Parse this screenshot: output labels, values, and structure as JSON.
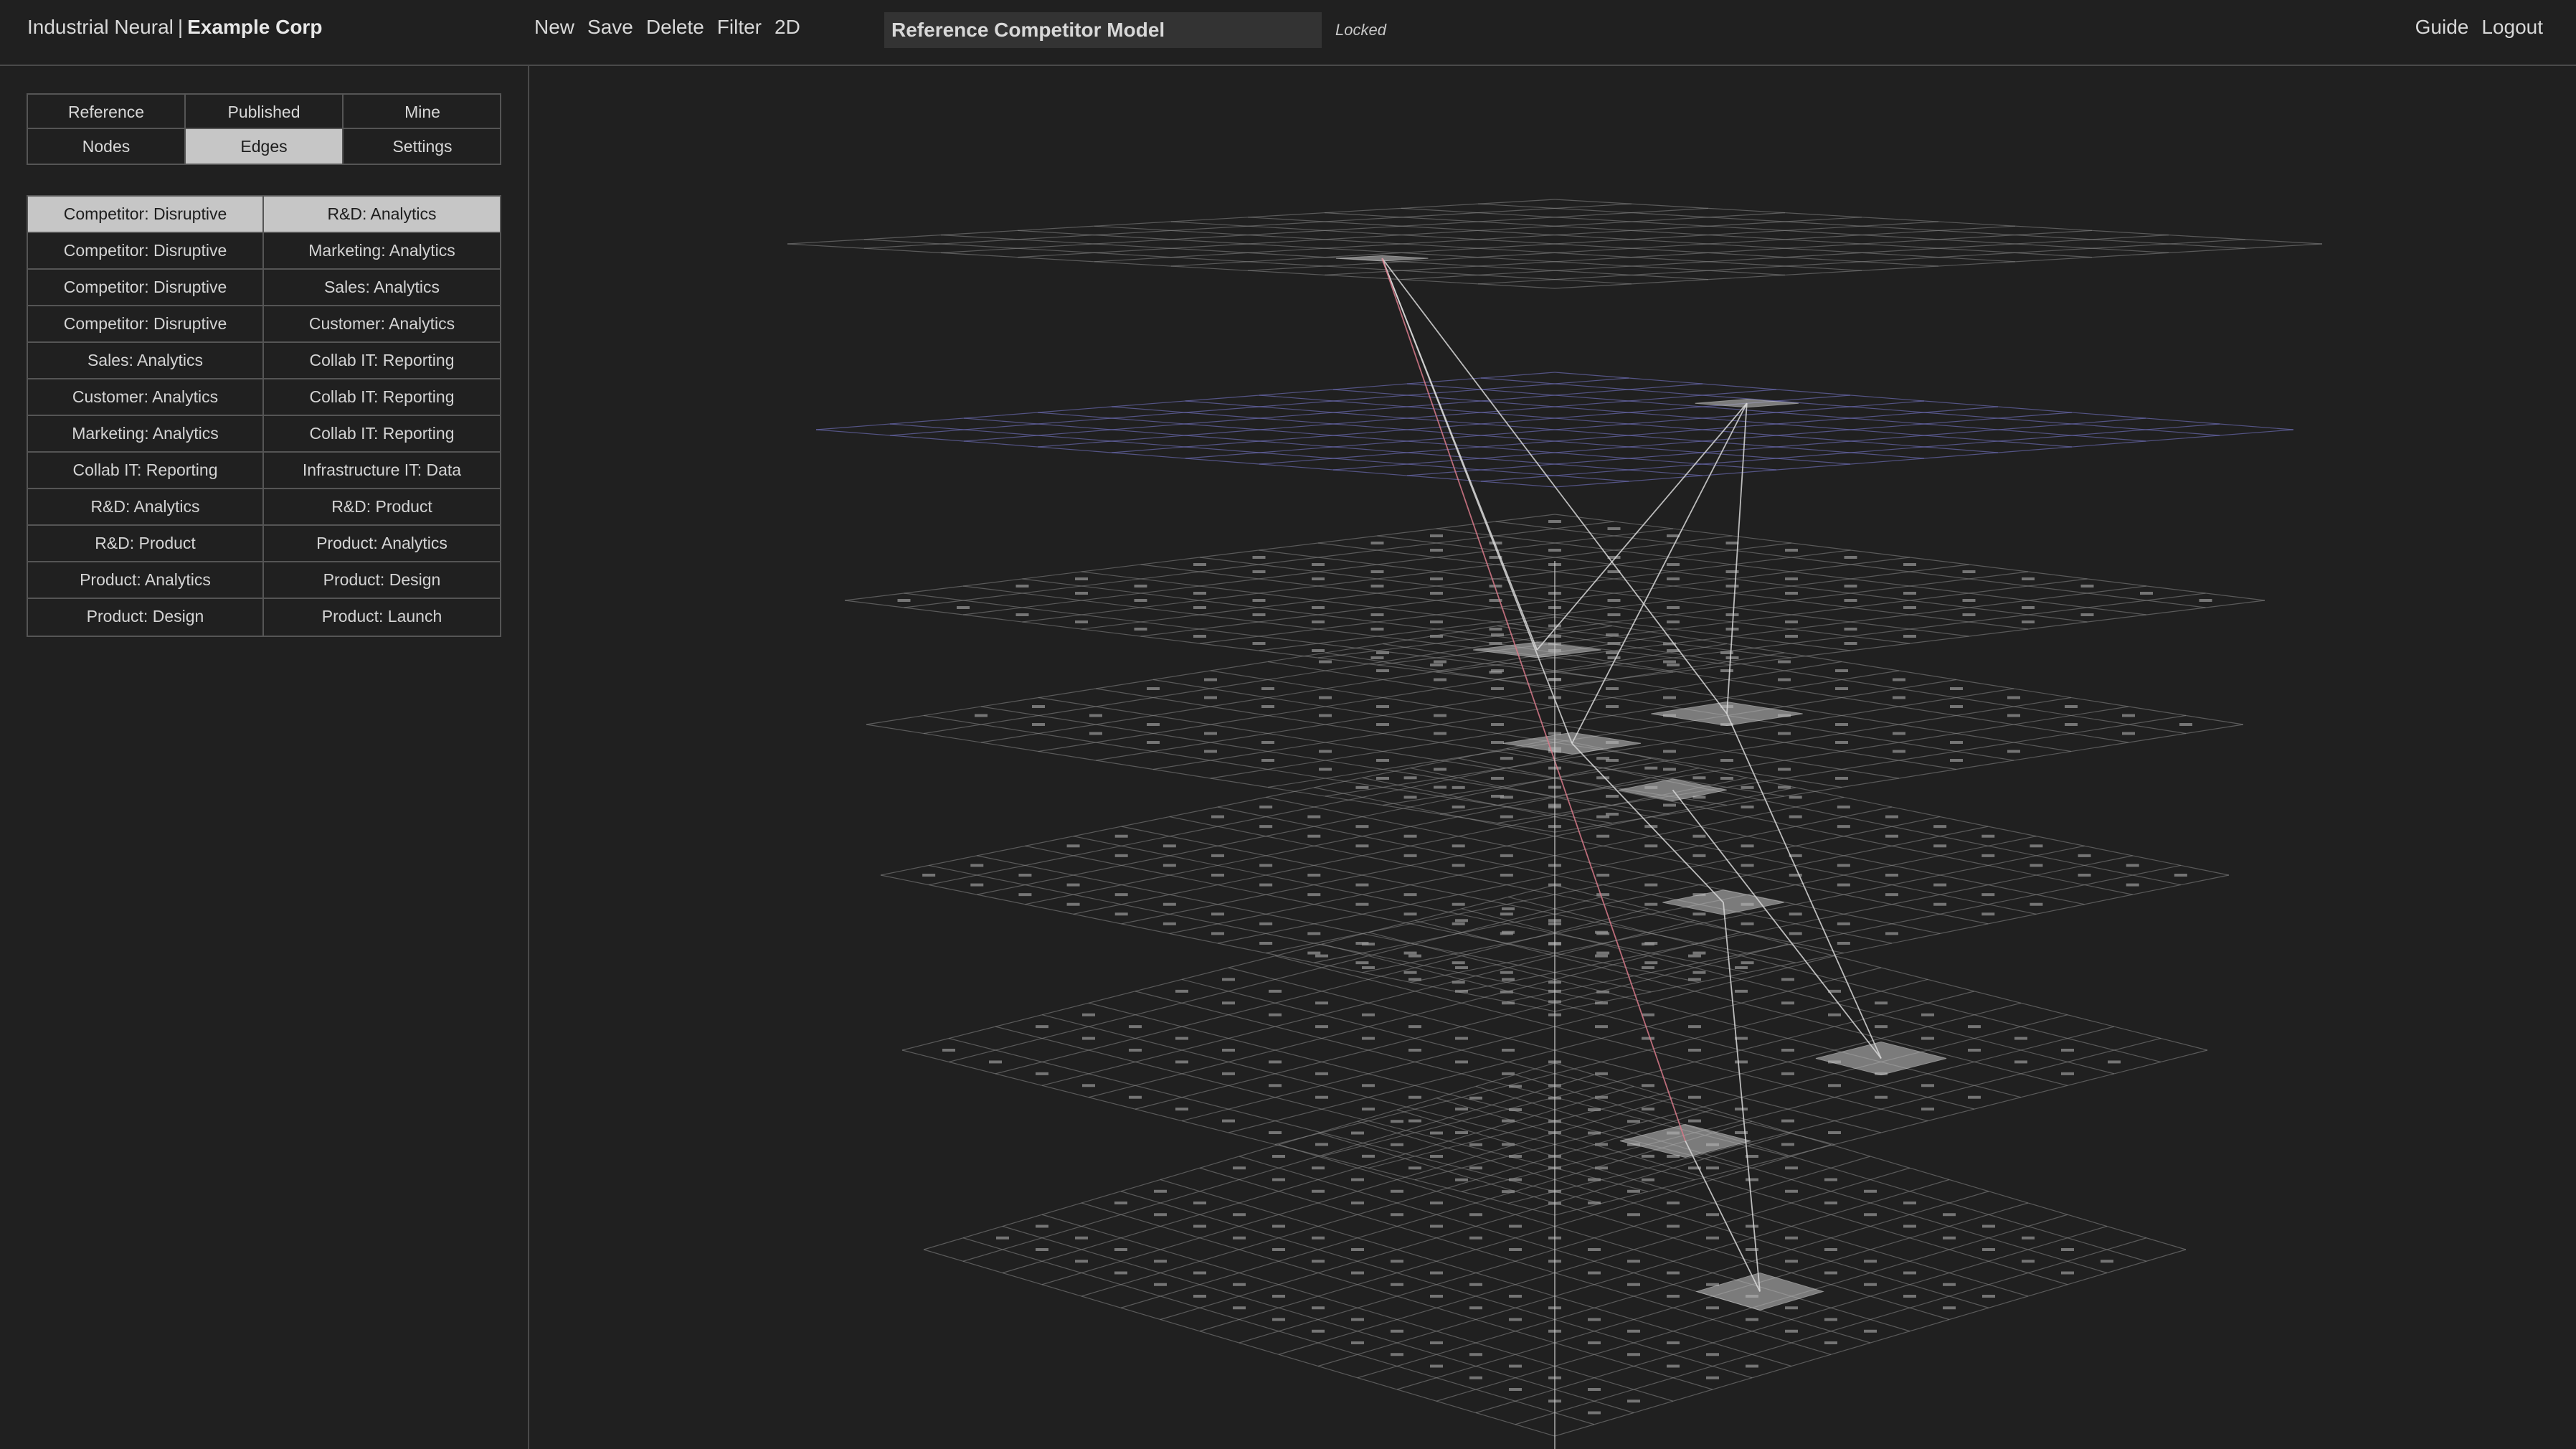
{
  "header": {
    "brand": "Industrial Neural",
    "separator": "|",
    "company": "Example Corp",
    "menu": [
      "New",
      "Save",
      "Delete",
      "Filter",
      "2D"
    ],
    "model_title": "Reference Competitor Model",
    "status": "Locked",
    "right_links": [
      "Guide",
      "Logout"
    ]
  },
  "sidebar": {
    "tabs": [
      {
        "label": "Reference",
        "active": false
      },
      {
        "label": "Published",
        "active": false
      },
      {
        "label": "Mine",
        "active": false
      },
      {
        "label": "Nodes",
        "active": false
      },
      {
        "label": "Edges",
        "active": true
      },
      {
        "label": "Settings",
        "active": false
      }
    ],
    "edges": [
      {
        "from": "Competitor: Disruptive",
        "to": "R&D: Analytics",
        "selected": true
      },
      {
        "from": "Competitor: Disruptive",
        "to": "Marketing: Analytics",
        "selected": false
      },
      {
        "from": "Competitor: Disruptive",
        "to": "Sales: Analytics",
        "selected": false
      },
      {
        "from": "Competitor: Disruptive",
        "to": "Customer: Analytics",
        "selected": false
      },
      {
        "from": "Sales: Analytics",
        "to": "Collab IT: Reporting",
        "selected": false
      },
      {
        "from": "Customer: Analytics",
        "to": "Collab IT: Reporting",
        "selected": false
      },
      {
        "from": "Marketing: Analytics",
        "to": "Collab IT: Reporting",
        "selected": false
      },
      {
        "from": "Collab IT: Reporting",
        "to": "Infrastructure IT: Data",
        "selected": false
      },
      {
        "from": "R&D: Analytics",
        "to": "R&D: Product",
        "selected": false
      },
      {
        "from": "R&D: Product",
        "to": "Product: Analytics",
        "selected": false
      },
      {
        "from": "Product: Analytics",
        "to": "Product: Design",
        "selected": false
      },
      {
        "from": "Product: Design",
        "to": "Product: Launch",
        "selected": false
      }
    ]
  },
  "viewport": {
    "colors": {
      "background": "#202020",
      "grid": "#8a8a8a",
      "grid_highlight": "#7f7fd8",
      "edge": "#d8d8d8",
      "edge_selected": "#d87a8a",
      "node": "#b8b8b8"
    }
  }
}
